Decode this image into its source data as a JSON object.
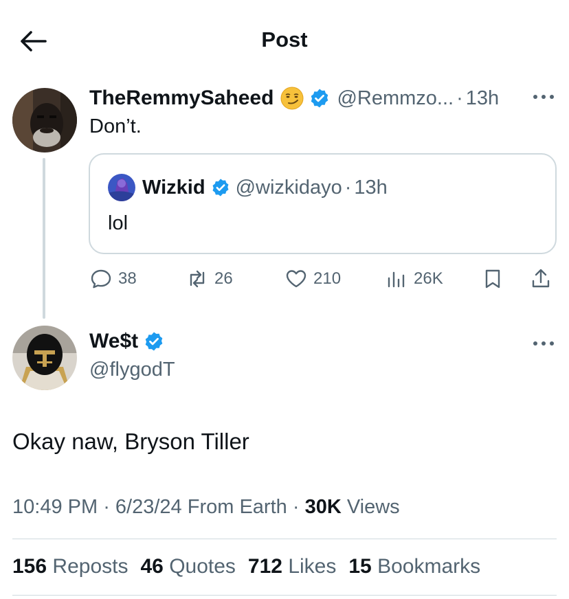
{
  "header": {
    "title": "Post"
  },
  "parent_post": {
    "name": "TheRemmySaheed",
    "handle": "@Remmzo...",
    "time": "13h",
    "text": "Don’t.",
    "quoted": {
      "name": "Wizkid",
      "handle": "@wizkidayo",
      "time": "13h",
      "text": "lol"
    },
    "actions": {
      "replies": "38",
      "reposts": "26",
      "likes": "210",
      "views": "26K"
    }
  },
  "main_post": {
    "name": "We$t",
    "handle": "@flygodT",
    "text": "Okay naw, Bryson Tiller",
    "time": "10:49 PM",
    "date": "6/23/24",
    "source": "From Earth",
    "views_count": "30K",
    "views_label": "Views",
    "stats": {
      "reposts_count": "156",
      "reposts_label": "Reposts",
      "quotes_count": "46",
      "quotes_label": "Quotes",
      "likes_count": "712",
      "likes_label": "Likes",
      "bookmarks_count": "15",
      "bookmarks_label": "Bookmarks"
    }
  },
  "colors": {
    "verified": "#1d9bf0",
    "text": "#0f1419",
    "muted": "#536471",
    "border": "#cfd9de"
  }
}
